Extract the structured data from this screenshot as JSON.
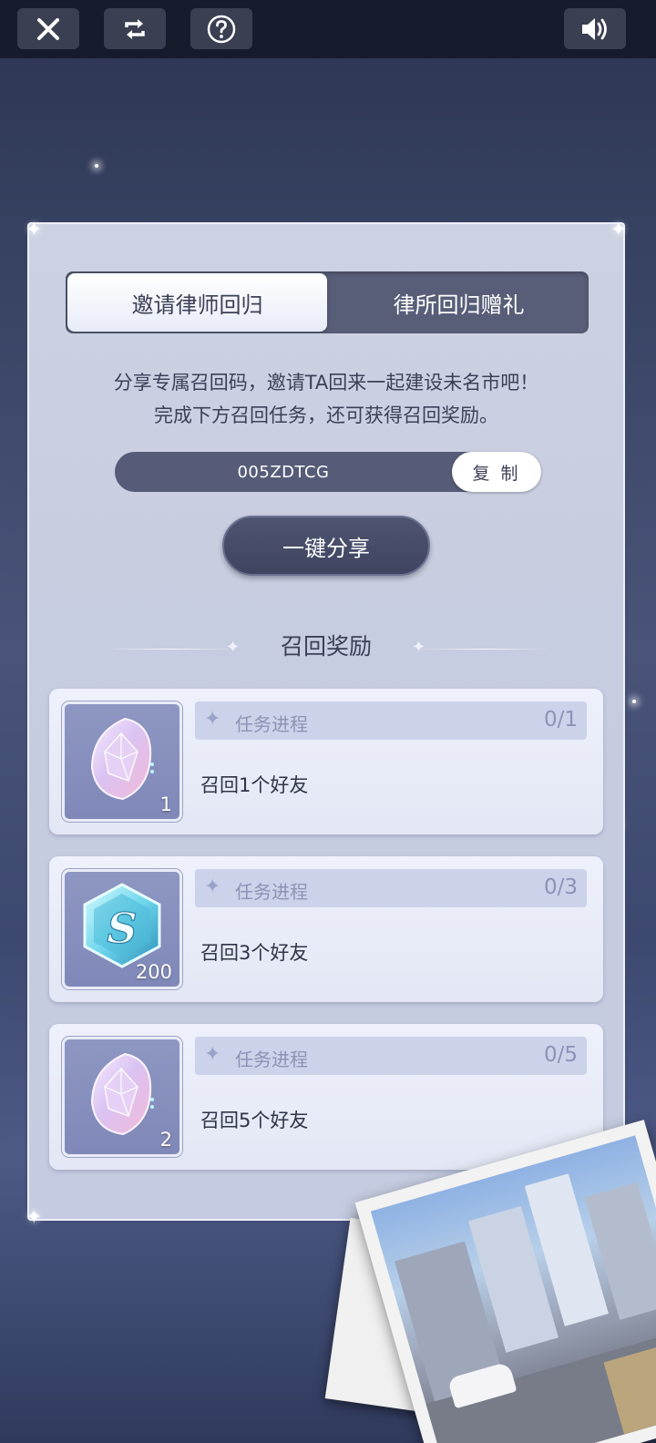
{
  "tabs": [
    {
      "label": "邀请律师回归",
      "active": true
    },
    {
      "label": "律所回归赠礼",
      "active": false
    }
  ],
  "intro": {
    "line1": "分享专属召回码，邀请TA回来一起建设未名市吧！",
    "line2": "完成下方召回任务，还可获得召回奖励。"
  },
  "code": {
    "value": "005ZDTCG",
    "copy_label": "复 制"
  },
  "share_label": "一键分享",
  "rewards_title": "召回奖励",
  "tasks": [
    {
      "progress_label": "任务进程",
      "progress": "0/1",
      "task": "召回1个好友",
      "item_count": "1",
      "item_icon": "crystal-icon"
    },
    {
      "progress_label": "任务进程",
      "progress": "0/3",
      "task": "召回3个好友",
      "item_count": "200",
      "item_icon": "s-coin-icon"
    },
    {
      "progress_label": "任务进程",
      "progress": "0/5",
      "task": "召回5个好友",
      "item_count": "2",
      "item_icon": "crystal-icon"
    }
  ],
  "icons": {
    "close": "close-icon",
    "refresh": "refresh-icon",
    "help": "help-icon",
    "sound": "sound-icon"
  }
}
